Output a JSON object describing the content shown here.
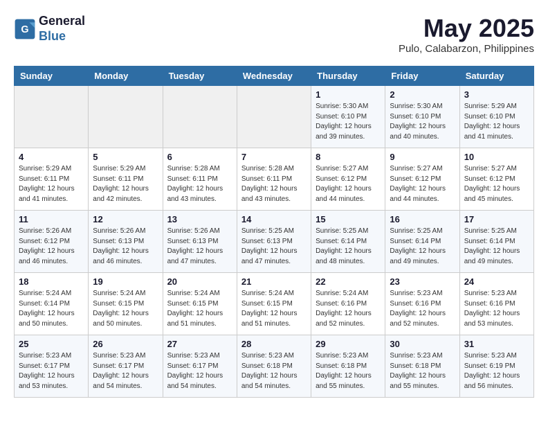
{
  "header": {
    "logo_line1": "General",
    "logo_line2": "Blue",
    "month_title": "May 2025",
    "subtitle": "Pulo, Calabarzon, Philippines"
  },
  "weekdays": [
    "Sunday",
    "Monday",
    "Tuesday",
    "Wednesday",
    "Thursday",
    "Friday",
    "Saturday"
  ],
  "weeks": [
    [
      {
        "day": "",
        "info": ""
      },
      {
        "day": "",
        "info": ""
      },
      {
        "day": "",
        "info": ""
      },
      {
        "day": "",
        "info": ""
      },
      {
        "day": "1",
        "info": "Sunrise: 5:30 AM\nSunset: 6:10 PM\nDaylight: 12 hours\nand 39 minutes."
      },
      {
        "day": "2",
        "info": "Sunrise: 5:30 AM\nSunset: 6:10 PM\nDaylight: 12 hours\nand 40 minutes."
      },
      {
        "day": "3",
        "info": "Sunrise: 5:29 AM\nSunset: 6:10 PM\nDaylight: 12 hours\nand 41 minutes."
      }
    ],
    [
      {
        "day": "4",
        "info": "Sunrise: 5:29 AM\nSunset: 6:11 PM\nDaylight: 12 hours\nand 41 minutes."
      },
      {
        "day": "5",
        "info": "Sunrise: 5:29 AM\nSunset: 6:11 PM\nDaylight: 12 hours\nand 42 minutes."
      },
      {
        "day": "6",
        "info": "Sunrise: 5:28 AM\nSunset: 6:11 PM\nDaylight: 12 hours\nand 43 minutes."
      },
      {
        "day": "7",
        "info": "Sunrise: 5:28 AM\nSunset: 6:11 PM\nDaylight: 12 hours\nand 43 minutes."
      },
      {
        "day": "8",
        "info": "Sunrise: 5:27 AM\nSunset: 6:12 PM\nDaylight: 12 hours\nand 44 minutes."
      },
      {
        "day": "9",
        "info": "Sunrise: 5:27 AM\nSunset: 6:12 PM\nDaylight: 12 hours\nand 44 minutes."
      },
      {
        "day": "10",
        "info": "Sunrise: 5:27 AM\nSunset: 6:12 PM\nDaylight: 12 hours\nand 45 minutes."
      }
    ],
    [
      {
        "day": "11",
        "info": "Sunrise: 5:26 AM\nSunset: 6:12 PM\nDaylight: 12 hours\nand 46 minutes."
      },
      {
        "day": "12",
        "info": "Sunrise: 5:26 AM\nSunset: 6:13 PM\nDaylight: 12 hours\nand 46 minutes."
      },
      {
        "day": "13",
        "info": "Sunrise: 5:26 AM\nSunset: 6:13 PM\nDaylight: 12 hours\nand 47 minutes."
      },
      {
        "day": "14",
        "info": "Sunrise: 5:25 AM\nSunset: 6:13 PM\nDaylight: 12 hours\nand 47 minutes."
      },
      {
        "day": "15",
        "info": "Sunrise: 5:25 AM\nSunset: 6:14 PM\nDaylight: 12 hours\nand 48 minutes."
      },
      {
        "day": "16",
        "info": "Sunrise: 5:25 AM\nSunset: 6:14 PM\nDaylight: 12 hours\nand 49 minutes."
      },
      {
        "day": "17",
        "info": "Sunrise: 5:25 AM\nSunset: 6:14 PM\nDaylight: 12 hours\nand 49 minutes."
      }
    ],
    [
      {
        "day": "18",
        "info": "Sunrise: 5:24 AM\nSunset: 6:14 PM\nDaylight: 12 hours\nand 50 minutes."
      },
      {
        "day": "19",
        "info": "Sunrise: 5:24 AM\nSunset: 6:15 PM\nDaylight: 12 hours\nand 50 minutes."
      },
      {
        "day": "20",
        "info": "Sunrise: 5:24 AM\nSunset: 6:15 PM\nDaylight: 12 hours\nand 51 minutes."
      },
      {
        "day": "21",
        "info": "Sunrise: 5:24 AM\nSunset: 6:15 PM\nDaylight: 12 hours\nand 51 minutes."
      },
      {
        "day": "22",
        "info": "Sunrise: 5:24 AM\nSunset: 6:16 PM\nDaylight: 12 hours\nand 52 minutes."
      },
      {
        "day": "23",
        "info": "Sunrise: 5:23 AM\nSunset: 6:16 PM\nDaylight: 12 hours\nand 52 minutes."
      },
      {
        "day": "24",
        "info": "Sunrise: 5:23 AM\nSunset: 6:16 PM\nDaylight: 12 hours\nand 53 minutes."
      }
    ],
    [
      {
        "day": "25",
        "info": "Sunrise: 5:23 AM\nSunset: 6:17 PM\nDaylight: 12 hours\nand 53 minutes."
      },
      {
        "day": "26",
        "info": "Sunrise: 5:23 AM\nSunset: 6:17 PM\nDaylight: 12 hours\nand 54 minutes."
      },
      {
        "day": "27",
        "info": "Sunrise: 5:23 AM\nSunset: 6:17 PM\nDaylight: 12 hours\nand 54 minutes."
      },
      {
        "day": "28",
        "info": "Sunrise: 5:23 AM\nSunset: 6:18 PM\nDaylight: 12 hours\nand 54 minutes."
      },
      {
        "day": "29",
        "info": "Sunrise: 5:23 AM\nSunset: 6:18 PM\nDaylight: 12 hours\nand 55 minutes."
      },
      {
        "day": "30",
        "info": "Sunrise: 5:23 AM\nSunset: 6:18 PM\nDaylight: 12 hours\nand 55 minutes."
      },
      {
        "day": "31",
        "info": "Sunrise: 5:23 AM\nSunset: 6:19 PM\nDaylight: 12 hours\nand 56 minutes."
      }
    ]
  ]
}
